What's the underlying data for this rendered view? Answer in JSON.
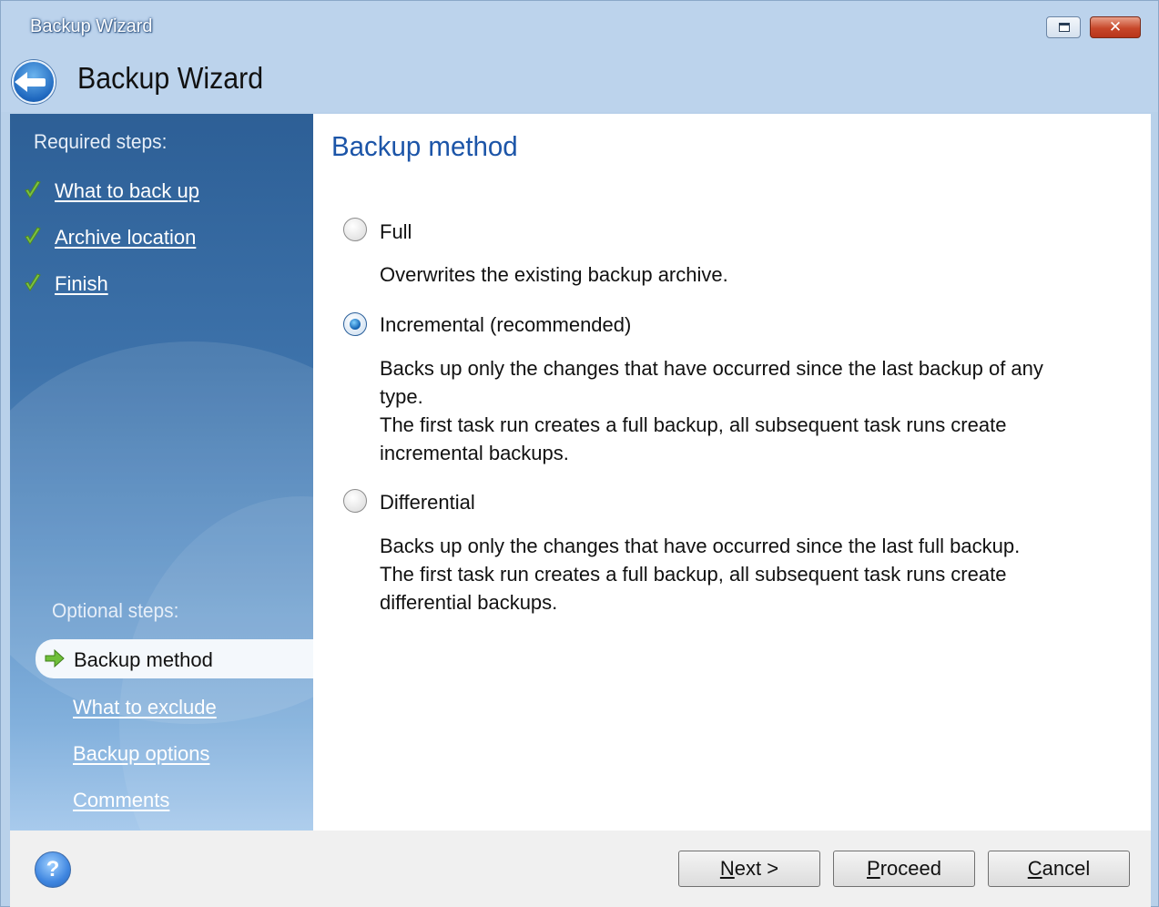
{
  "window": {
    "title": "Backup Wizard",
    "header_title": "Backup Wizard",
    "close_glyph": "✕"
  },
  "sidebar": {
    "required_heading": "Required steps:",
    "required_steps": [
      {
        "label": "What to back up",
        "icon": "check-icon"
      },
      {
        "label": "Archive location",
        "icon": "check-icon"
      },
      {
        "label": "Finish",
        "icon": "check-icon"
      }
    ],
    "optional_heading": "Optional steps:",
    "active_step": {
      "label": "Backup method",
      "icon": "arrow-right-icon"
    },
    "optional_steps": [
      {
        "label": "What to exclude"
      },
      {
        "label": "Backup options"
      },
      {
        "label": "Comments"
      }
    ]
  },
  "content": {
    "title": "Backup method",
    "options": [
      {
        "label": "Full",
        "checked": false,
        "description": [
          "Overwrites the existing backup archive."
        ]
      },
      {
        "label": "Incremental (recommended)",
        "checked": true,
        "description": [
          "Backs up only the changes that have occurred since the last backup of any",
          "type.",
          "The first task run creates a full backup, all subsequent task runs create",
          "incremental backups."
        ]
      },
      {
        "label": "Differential",
        "checked": false,
        "description": [
          "Backs up only the changes that have occurred since the last full backup.",
          "The first task run creates a full backup, all subsequent task runs create",
          "differential backups."
        ]
      }
    ]
  },
  "footer": {
    "help_glyph": "?",
    "next": {
      "accel": "N",
      "rest": "ext >"
    },
    "proceed": {
      "accel": "P",
      "rest": "roceed"
    },
    "cancel": {
      "accel": "C",
      "rest": "ancel"
    }
  },
  "colors": {
    "title_blue": "#1c55a8",
    "sidebar_dark": "#2d5f96",
    "sidebar_light": "#a8caec",
    "chrome": "#bcd3ec",
    "check_green": "#7cc242"
  }
}
